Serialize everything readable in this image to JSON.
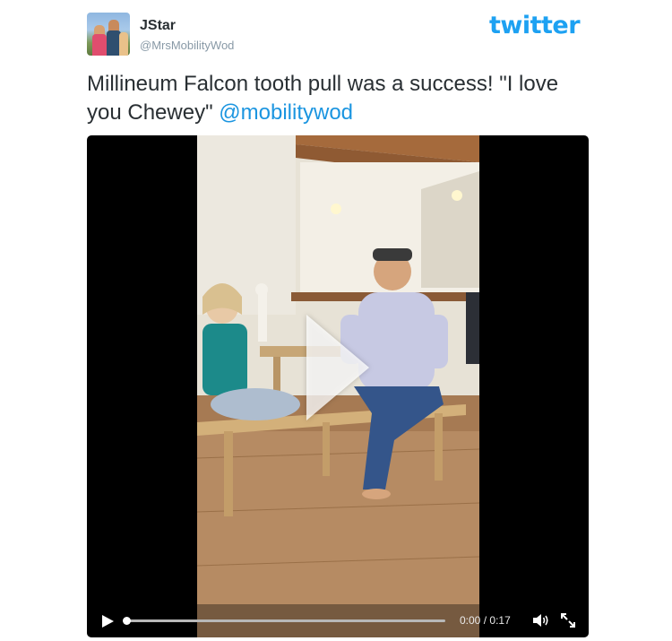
{
  "author": {
    "name": "JStar",
    "handle": "@MrsMobilityWod"
  },
  "brand": {
    "logo_text": "twitter",
    "color": "#1da1f2"
  },
  "tweet": {
    "text": "Millineum Falcon tooth pull was a success! \"I love you Chewey\"",
    "mention": "@mobilitywod"
  },
  "video": {
    "current_time": "0:00",
    "separator": "/",
    "duration": "0:17",
    "progress": 0
  },
  "icons": {
    "play": "play-icon",
    "volume": "volume-icon",
    "fullscreen": "fullscreen-icon"
  }
}
